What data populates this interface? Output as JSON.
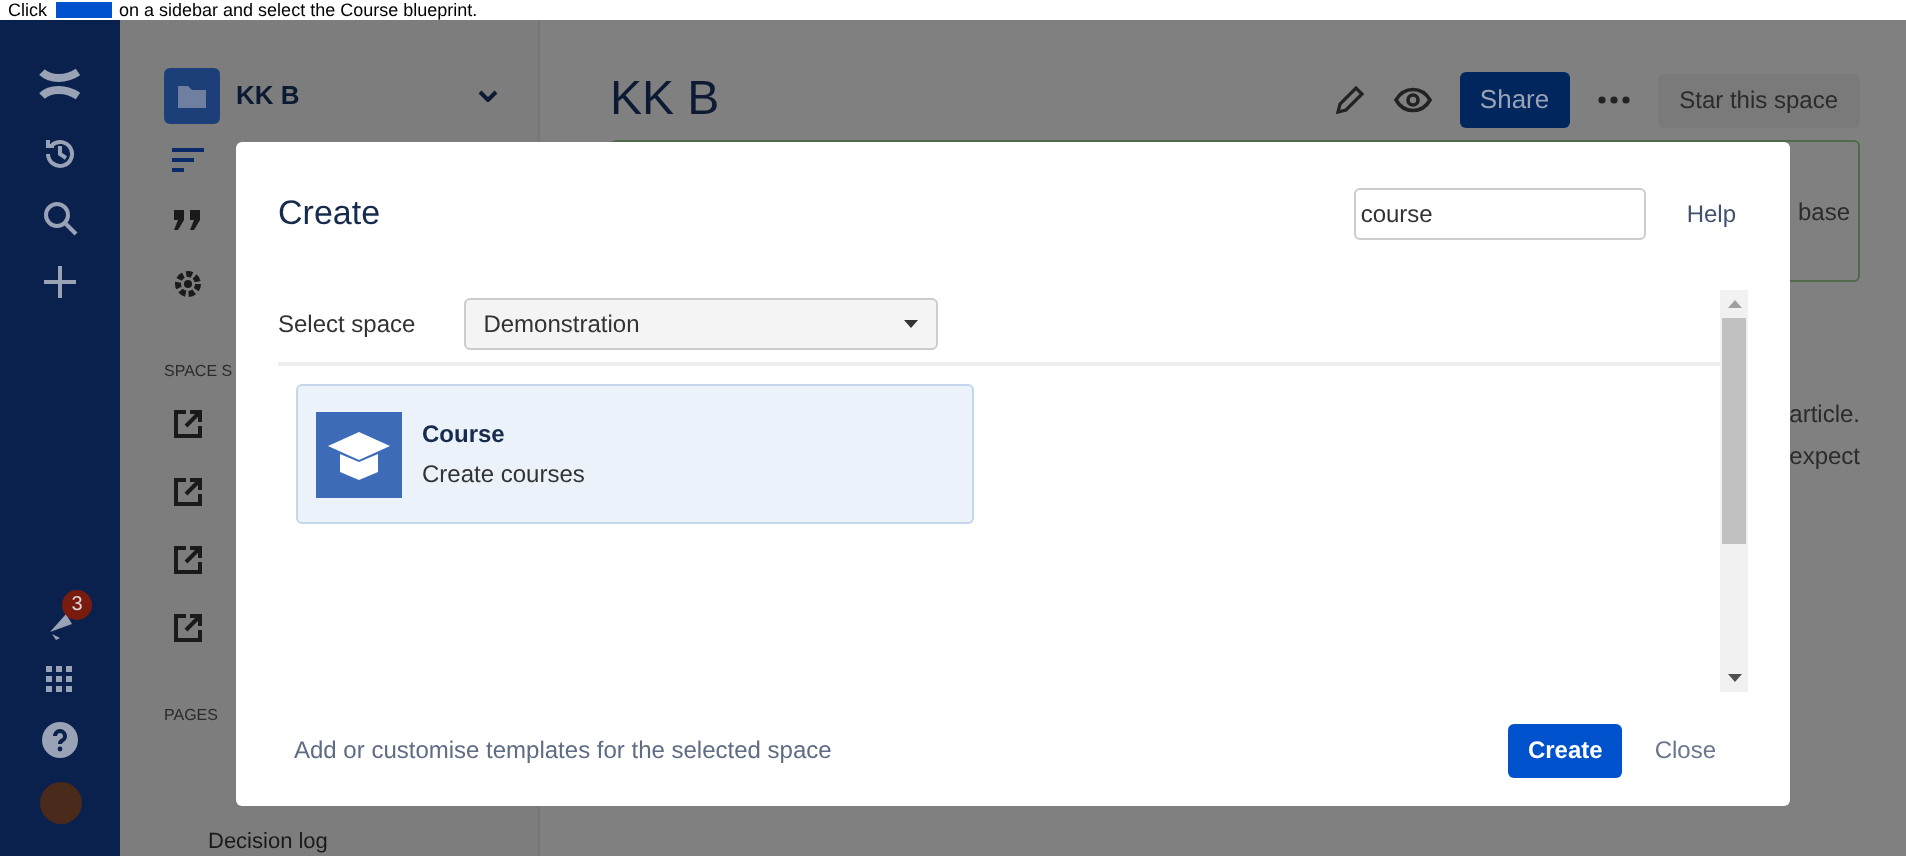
{
  "instruction": {
    "before": "Click",
    "after": "on a sidebar and select the Course blueprint."
  },
  "nav": {
    "notification_count": "3"
  },
  "sidebar": {
    "space_name": "KK B",
    "section_label": "SPACE S",
    "pages_label": "PAGES",
    "page_item": "Decision log"
  },
  "page": {
    "title": "KK B",
    "share": "Share",
    "star": "Star this space",
    "banner_fragment": "base",
    "text_fragments": [
      "article.",
      "expect"
    ]
  },
  "dialog": {
    "title": "Create",
    "search": {
      "value": "course"
    },
    "help": "Help",
    "select_space_label": "Select space",
    "space": "Demonstration",
    "blueprints": [
      {
        "name": "Course",
        "description": "Create courses",
        "selected": true
      }
    ],
    "footer_link": "Add or customise templates for the selected space",
    "create": "Create",
    "close": "Close"
  }
}
